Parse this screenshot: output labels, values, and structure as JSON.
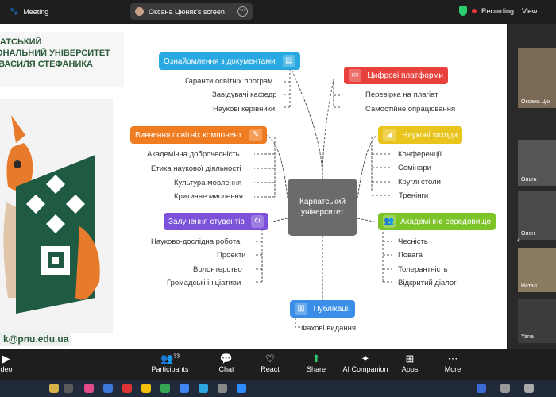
{
  "window": {
    "app_title": "Meeting",
    "screen_share_label": "Оксана Цюняк's screen",
    "recording_label": "Recording",
    "view_label": "View",
    "colors": {
      "accent": "#2ecc71",
      "recording": "#e53935"
    }
  },
  "slide": {
    "university_name": [
      "ПАТСЬКИЙ",
      "ІОНАЛЬНИЙ УНІВЕРСИТЕТ",
      "І ВАСИЛЯ СТЕФАНИКА"
    ],
    "email": "k@pnu.edu.ua",
    "center_node": "Карпатський університет",
    "branches": [
      {
        "key": "documents",
        "title": "Ознайомлення з документами",
        "color": "#29a9e1",
        "items": [
          "Гаранти освітніх програм",
          "Завідувачі кафедр",
          "Наукові керівники"
        ]
      },
      {
        "key": "components",
        "title": "Вивчення освітніх компонент",
        "color": "#f07c22",
        "items": [
          "Академічна доброчесність",
          "Етика наукової діяльності",
          "Культура мовлення",
          "Критичне мислення"
        ]
      },
      {
        "key": "students",
        "title": "Залучення студентів",
        "color": "#7b52d9",
        "items": [
          "Науково-дослідна робота",
          "Проекти",
          "Волонтерство",
          "Громадські ініціативи"
        ]
      },
      {
        "key": "publications",
        "title": "Публікації",
        "color": "#3b8ee8",
        "items": [
          "Фахові видання"
        ]
      },
      {
        "key": "platforms",
        "title": "Цифрові платформи",
        "color": "#e8403b",
        "items": [
          "Перевірка на плагіат",
          "Самостійне опрацювання"
        ]
      },
      {
        "key": "events",
        "title": "Наукові заходи",
        "color": "#e9c41c",
        "items": [
          "Конференції",
          "Семінари",
          "Круглі столи",
          "Тренінги"
        ]
      },
      {
        "key": "environment",
        "title": "Академічне середовище",
        "color": "#7cc428",
        "items": [
          "Чесність",
          "Повага",
          "Толерантність",
          "Відкритий діалог"
        ]
      }
    ]
  },
  "participants_panel": {
    "tiles": [
      {
        "name": "Оксана Цю"
      },
      {
        "name": "Ольга"
      },
      {
        "name": "Олен"
      },
      {
        "name": "Натал"
      },
      {
        "name": "Yana"
      }
    ]
  },
  "controls": {
    "video_label": "deo",
    "participants_label": "Participants",
    "participants_count": "33",
    "chat_label": "Chat",
    "react_label": "React",
    "share_label": "Share",
    "ai_label": "AI Companion",
    "apps_label": "Apps",
    "more_label": "More"
  }
}
